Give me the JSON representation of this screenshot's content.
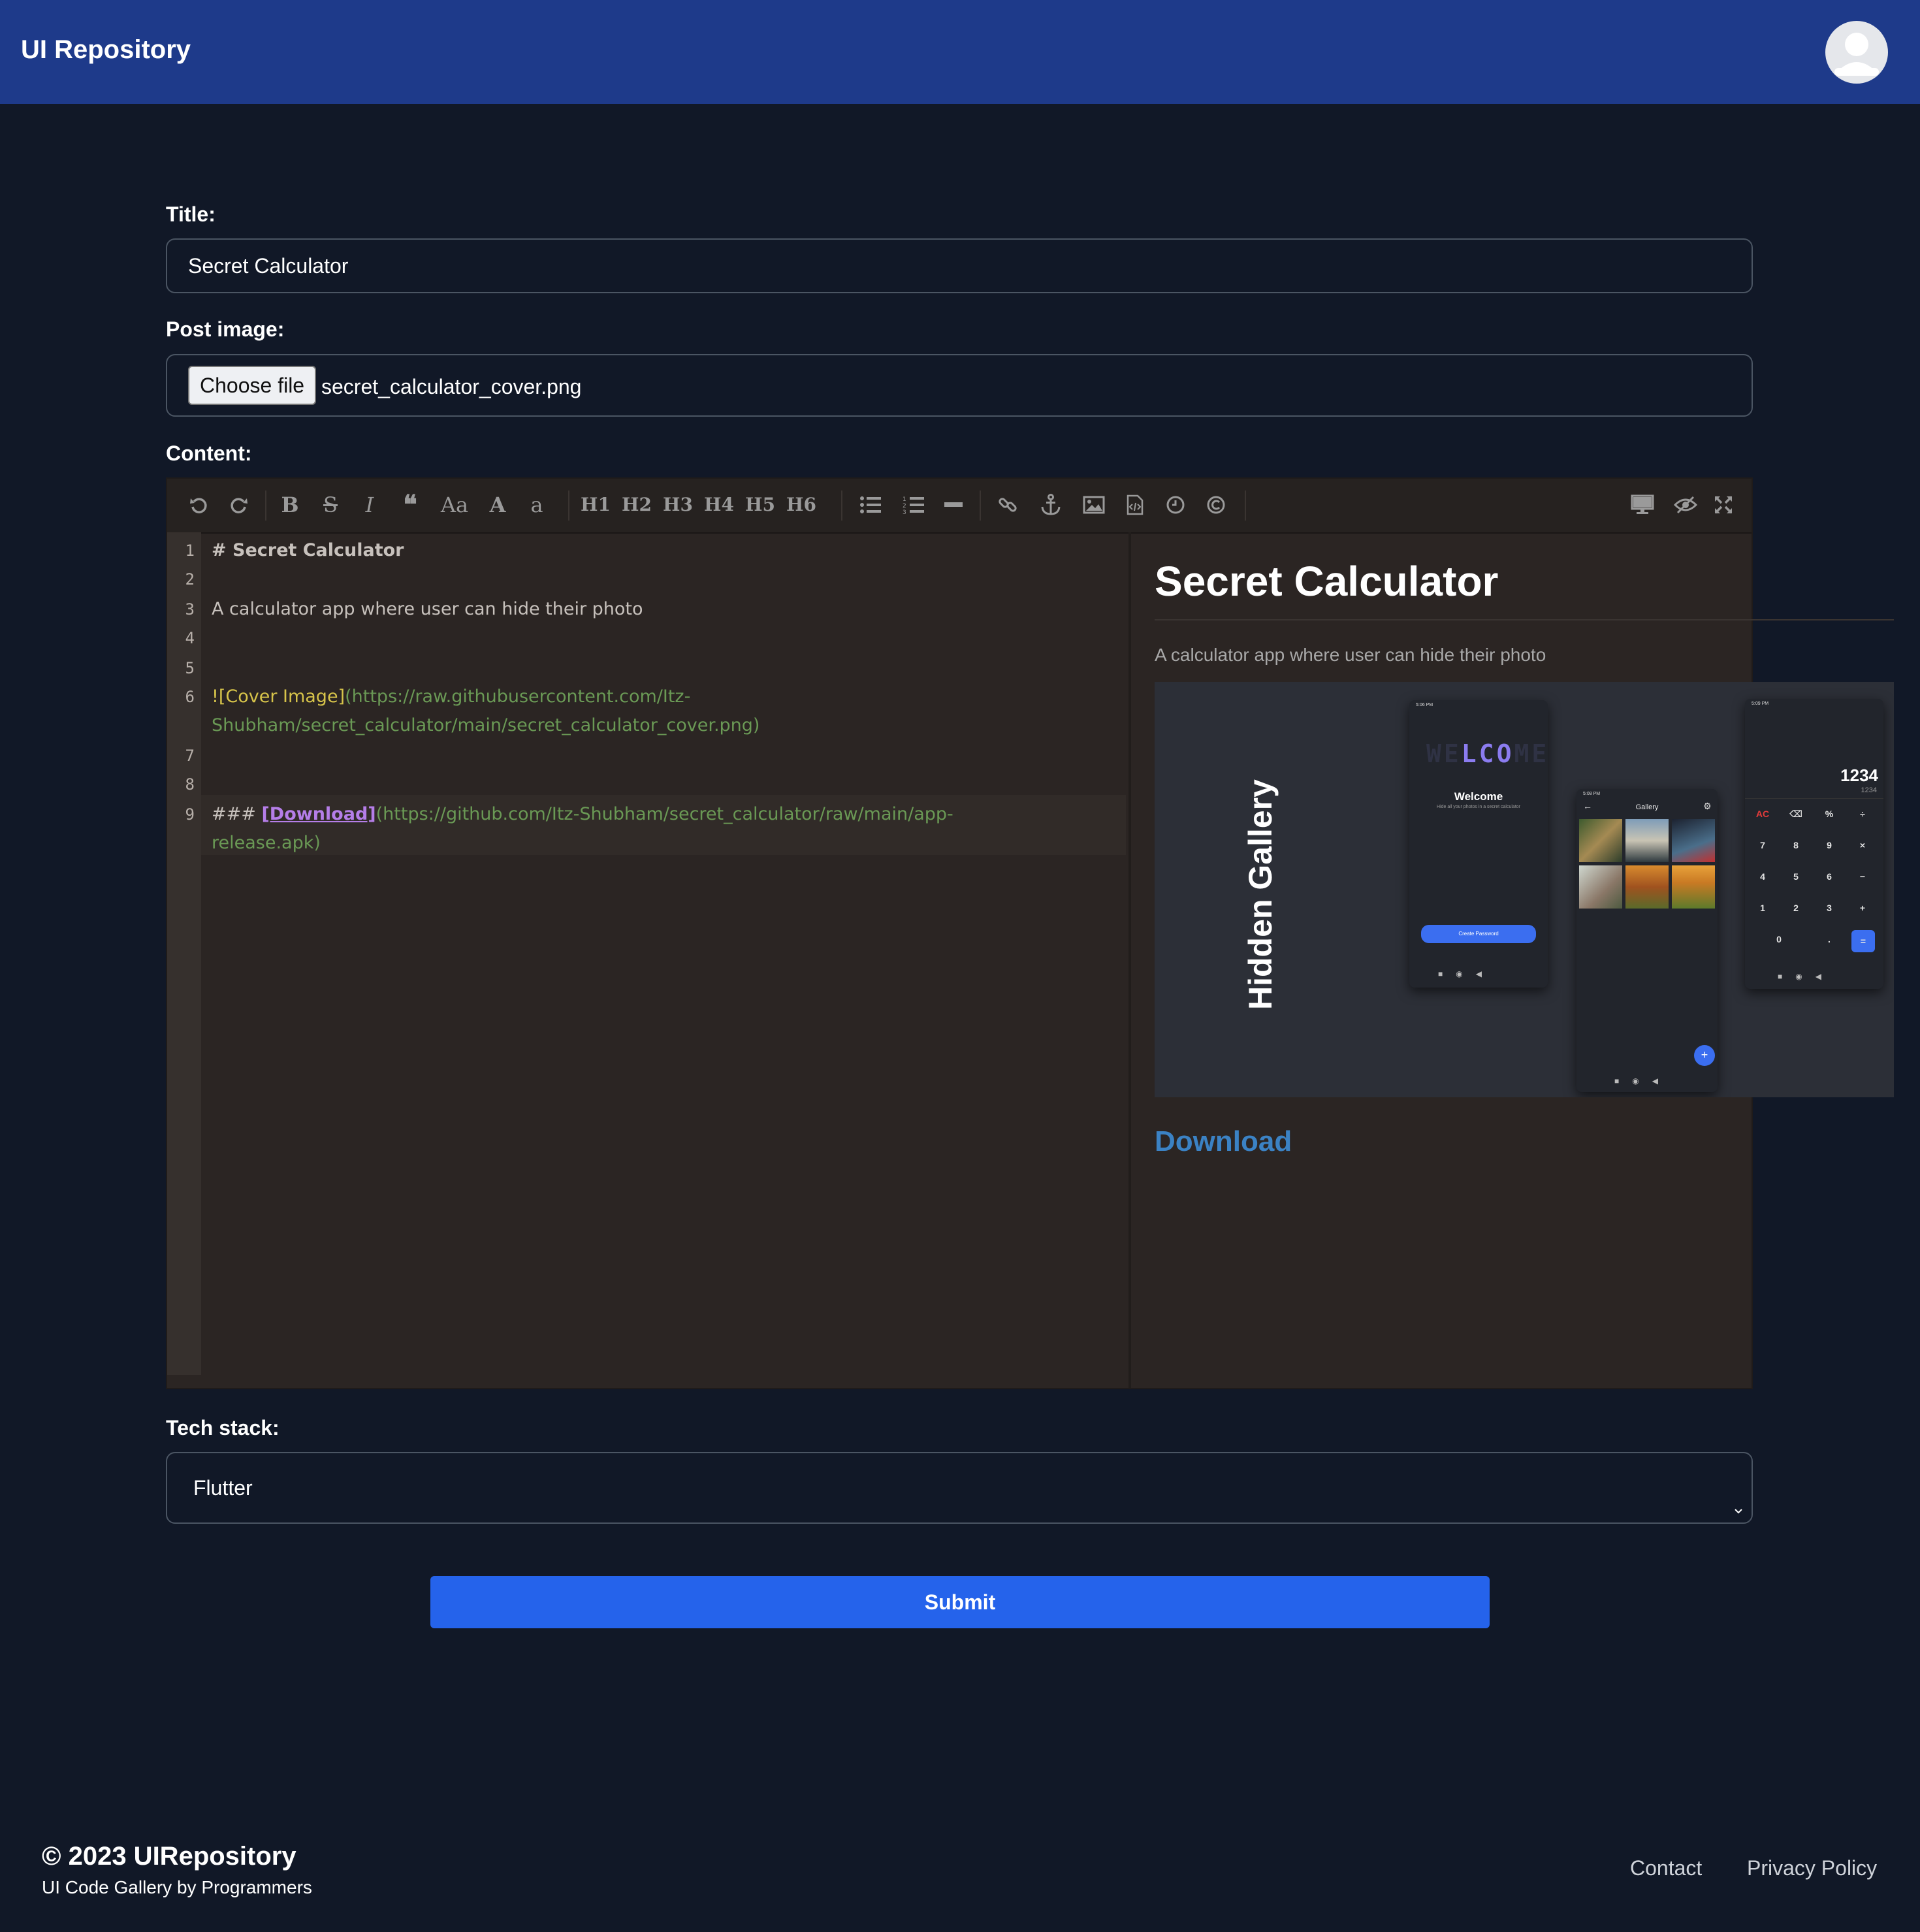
{
  "header": {
    "brand": "UI Repository"
  },
  "form": {
    "title_label": "Title:",
    "title_value": "Secret Calculator",
    "image_label": "Post image:",
    "choose_file": "Choose file",
    "file_name": "secret_calculator_cover.png",
    "content_label": "Content:",
    "tech_label": "Tech stack:",
    "tech_value": "Flutter",
    "submit": "Submit"
  },
  "toolbar": {
    "headings": [
      "H1",
      "H2",
      "H3",
      "H4",
      "H5",
      "H6"
    ],
    "case_label": "Aa",
    "upper_label": "A",
    "lower_label": "a",
    "bold_label": "B",
    "strike_label": "S",
    "italic_label": "I",
    "quote_label": "❝"
  },
  "editor": {
    "line_numbers": [
      "1",
      "2",
      "3",
      "4",
      "5",
      "6",
      "7",
      "8",
      "9"
    ],
    "line1": "# Secret Calculator",
    "line3": "A calculator app where user can hide their photo",
    "line6_alt": "![Cover Image]",
    "line6_url_a": "(https://raw.githubusercontent.com/Itz-",
    "line6_url_b": "Shubham/secret_calculator/main/secret_calculator_cover.png)",
    "line9_hash": "### ",
    "line9_link": "[Download]",
    "line9_url_a": "(https://github.com/Itz-Shubham/secret_calculator/raw/main/app-",
    "line9_url_b": "release.apk)"
  },
  "preview": {
    "title": "Secret Calculator",
    "text": "A calculator app where user can hide their photo",
    "link": "Download",
    "image": {
      "side_label": "Hidden Gallery",
      "welcome_art": "WELCOME",
      "welcome_heading": "Welcome",
      "welcome_sub": "Hide all your photos in a secret calculator",
      "create_password": "Create Password",
      "gallery_title": "Gallery",
      "calc_display": "1234",
      "calc_sub": "1234",
      "calc_keys": [
        "AC",
        "⌫",
        "%",
        "÷",
        "7",
        "8",
        "9",
        "×",
        "4",
        "5",
        "6",
        "−",
        "1",
        "2",
        "3",
        "+",
        "0",
        ".",
        "="
      ],
      "status_time_1": "5:06 PM",
      "status_time_2": "5:08 PM",
      "status_time_3": "5:09 PM"
    }
  },
  "footer": {
    "copyright": "© 2023 UIRepository",
    "tagline": "UI Code Gallery by Programmers",
    "contact": "Contact",
    "privacy": "Privacy Policy"
  },
  "colors": {
    "page_bg": "#111827",
    "header_bg": "#1e3a8a",
    "submit_bg": "#2563eb",
    "link": "#3b82c4"
  },
  "icons": [
    "user-avatar-icon",
    "undo-icon",
    "redo-icon",
    "list-ul-icon",
    "list-ol-icon",
    "horizontal-rule-icon",
    "link-icon",
    "anchor-icon",
    "image-icon",
    "code-file-icon",
    "clock-icon",
    "copyright-icon",
    "desktop-preview-icon",
    "eye-off-icon",
    "fullscreen-icon",
    "chevron-down-icon"
  ]
}
